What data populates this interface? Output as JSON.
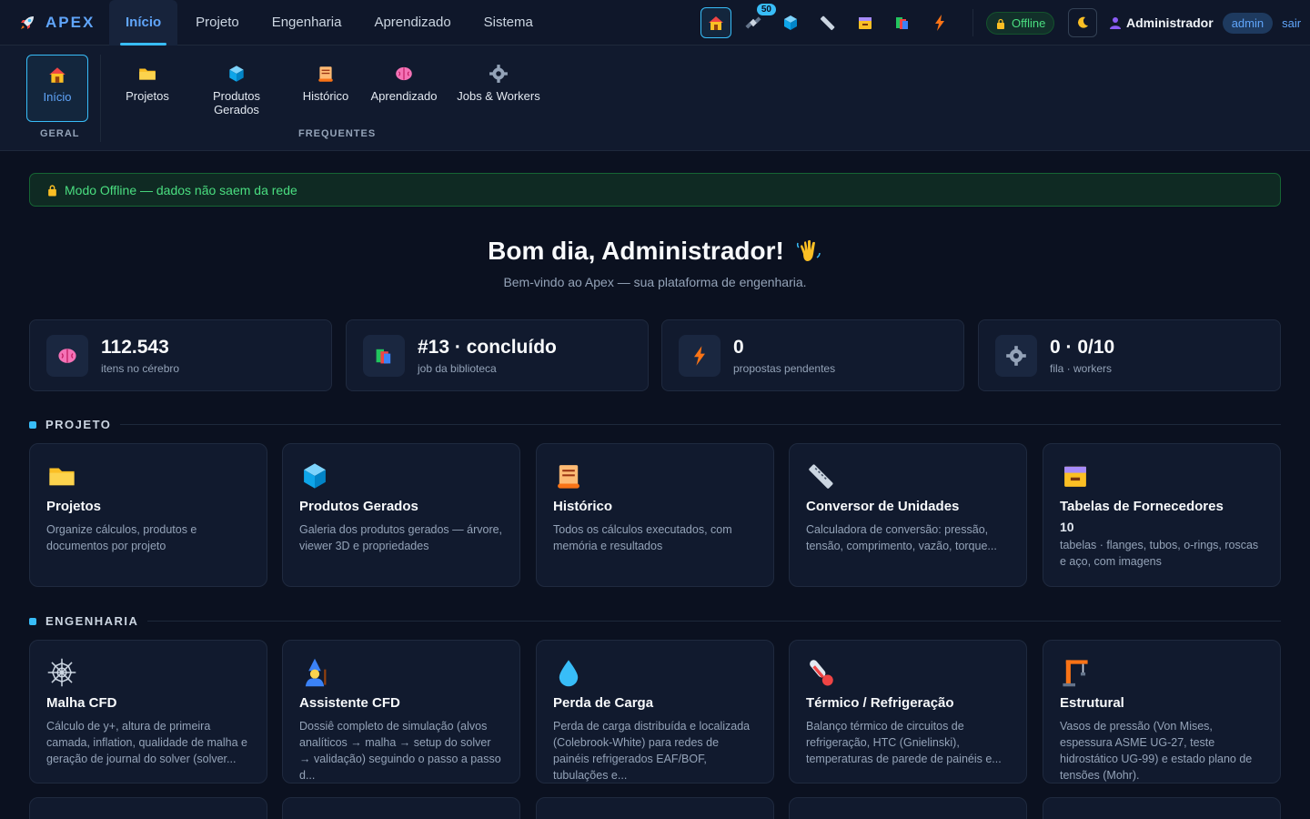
{
  "app": {
    "name": "APEX"
  },
  "nav": {
    "tabs": [
      "Início",
      "Projeto",
      "Engenharia",
      "Aprendizado",
      "Sistema"
    ],
    "active_tab": 0,
    "notification_count": "50"
  },
  "status": {
    "offline_label": "Offline",
    "user_name": "Administrador",
    "role": "admin",
    "logout": "sair"
  },
  "ribbon": {
    "items": [
      {
        "label": "Início",
        "icon": "house-icon"
      },
      {
        "label": "Projetos",
        "icon": "folder-icon"
      },
      {
        "label": "Produtos Gerados",
        "icon": "cube-icon"
      },
      {
        "label": "Histórico",
        "icon": "scroll-icon"
      },
      {
        "label": "Aprendizado",
        "icon": "brain-icon"
      },
      {
        "label": "Jobs & Workers",
        "icon": "gear-icon"
      }
    ],
    "groups": [
      "GERAL",
      "FREQUENTES"
    ]
  },
  "banner": {
    "text": "Modo Offline — dados não saem da rede"
  },
  "greeting": {
    "title": "Bom dia, Administrador!",
    "subtitle": "Bem-vindo ao Apex — sua plataforma de engenharia."
  },
  "stats": [
    {
      "value": "112.543",
      "label": "itens no cérebro",
      "icon": "brain-icon"
    },
    {
      "value": "#13 · concluído",
      "label": "job da biblioteca",
      "icon": "books-icon"
    },
    {
      "value": "0",
      "label": "propostas pendentes",
      "icon": "lightning-icon"
    },
    {
      "value": "0 · 0/10",
      "label": "fila · workers",
      "icon": "gear-icon"
    }
  ],
  "sections": {
    "projeto": {
      "title": "PROJETO",
      "cards": [
        {
          "title": "Projetos",
          "desc": "Organize cálculos, produtos e documentos por projeto",
          "icon": "folder-icon"
        },
        {
          "title": "Produtos Gerados",
          "desc": "Galeria dos produtos gerados — árvore, viewer 3D e propriedades",
          "icon": "cube-icon"
        },
        {
          "title": "Histórico",
          "desc": "Todos os cálculos executados, com memória e resultados",
          "icon": "scroll-icon"
        },
        {
          "title": "Conversor de Unidades",
          "desc": "Calculadora de conversão: pressão, tensão, comprimento, vazão, torque...",
          "icon": "ruler-icon"
        },
        {
          "title": "Tabelas de Fornecedores",
          "count": "10",
          "desc": "tabelas · flanges, tubos, o-rings, roscas e aço, com imagens",
          "icon": "file-box-icon"
        }
      ]
    },
    "engenharia": {
      "title": "ENGENHARIA",
      "cards": [
        {
          "title": "Malha CFD",
          "desc": "Cálculo de y+, altura de primeira camada, inflation, qualidade de malha e geração de journal do solver (solver...",
          "icon": "spider-web-icon"
        },
        {
          "title": "Assistente CFD",
          "desc": "Dossiê completo de simulação (alvos analíticos → malha → setup do solver → validação) seguindo o passo a passo d...",
          "icon": "wizard-icon"
        },
        {
          "title": "Perda de Carga",
          "desc": "Perda de carga distribuída e localizada (Colebrook-White) para redes de painéis refrigerados EAF/BOF, tubulações e...",
          "icon": "droplet-icon"
        },
        {
          "title": "Térmico / Refrigeração",
          "desc": "Balanço térmico de circuitos de refrigeração, HTC (Gnielinski), temperaturas de parede de painéis e...",
          "icon": "thermometer-icon"
        },
        {
          "title": "Estrutural",
          "desc": "Vasos de pressão (Von Mises, espessura ASME UG-27, teste hidrostático UG-99) e estado plano de tensões (Mohr).",
          "icon": "crane-icon"
        }
      ]
    }
  },
  "colors": {
    "accent": "#38bdf8",
    "success": "#4ade80",
    "background": "#0b1120",
    "card": "#111a2e"
  }
}
